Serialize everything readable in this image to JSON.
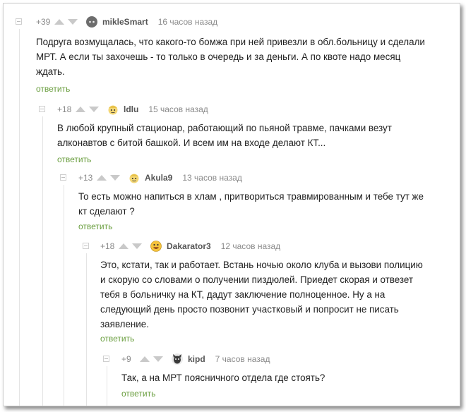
{
  "comments": [
    {
      "rating": "+39",
      "username": "mikleSmart",
      "time": "16 часов назад",
      "lines": [
        "Подруга возмущалась, что какого-то бомжа при ней привезли в обл.больницу и сделали",
        "МРТ. А если ты захочешь - то только в очередь и за деньги. А по квоте надо месяц",
        "ждать."
      ],
      "reply_label": "ответить",
      "avatar_icon": "cat-avatar-icon"
    },
    {
      "rating": "+18",
      "username": "ldlu",
      "time": "15 часов назад",
      "lines": [
        "В любой крупный стационар, работающий по пьяной травме, пачками везут",
        "алконавтов с битой башкой. И всем им на входе делают КТ..."
      ],
      "reply_label": "ответить",
      "avatar_icon": "cartoon-avatar-icon"
    },
    {
      "rating": "+13",
      "username": "Akula9",
      "time": "13 часов назад",
      "lines": [
        "То есть можно напиться в хлам , притвориться травмированным и тебе тут же",
        "кт сделают ?"
      ],
      "reply_label": "ответить",
      "avatar_icon": "cartoon-avatar-icon"
    },
    {
      "rating": "+18",
      "username": "Dakarator3",
      "time": "12 часов назад",
      "lines": [
        "Это, кстати, так и работает. Встань ночью около клуба и вызови полицию",
        "и скорую со словами о получении пиздюлей. Приедет скорая и отвезет",
        "тебя в больничку на КТ, дадут заключение полноценное. Ну а на",
        "следующий день просто позвонит участковый и попросит не писать",
        "заявление."
      ],
      "reply_label": "ответить",
      "avatar_icon": "smiley-avatar-icon"
    },
    {
      "rating": "+9",
      "username": "kipd",
      "time": "7 часов назад",
      "lines": [
        "Так, а на МРТ поясничного отдела где стоять?"
      ],
      "reply_label": "ответить",
      "avatar_icon": "animal-avatar-icon"
    }
  ],
  "colors": {
    "reply": "#6a9e3f",
    "meta": "#8a8a8a",
    "username": "#555555",
    "text": "#222222",
    "arrow": "#c9c9c9"
  }
}
